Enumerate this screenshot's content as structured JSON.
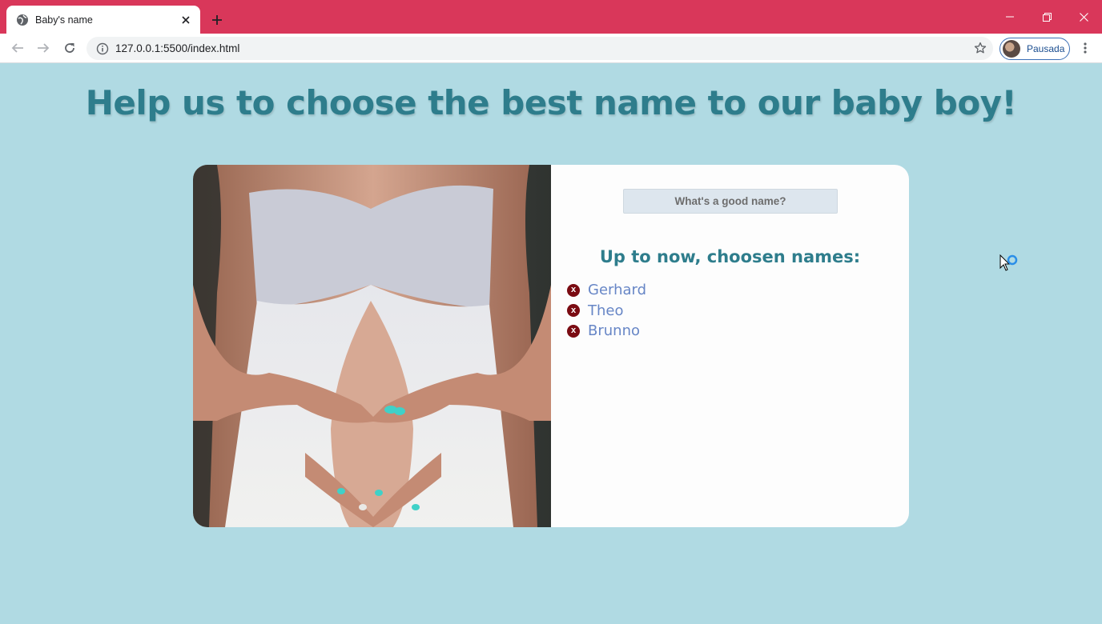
{
  "browser": {
    "tab_title": "Baby's name",
    "url": "127.0.0.1:5500/index.html",
    "profile_label": "Pausada",
    "accent_color": "#d9375a"
  },
  "page": {
    "headline": "Help us to choose the best name to our baby boy!",
    "input_placeholder": "What's a good name?",
    "list_title": "Up to now, choosen names:",
    "remove_label": "x",
    "names": [
      "Gerhard",
      "Theo",
      "Brunno"
    ],
    "background_color": "#b0dae3",
    "title_color": "#2e7d8c",
    "name_color": "#6786c6",
    "remove_color": "#7a0b12"
  },
  "icons": [
    "globe-icon",
    "close-icon",
    "plus-icon",
    "minimize-icon",
    "restore-icon",
    "back-arrow-icon",
    "forward-arrow-icon",
    "reload-icon",
    "info-icon",
    "star-icon",
    "menu-dots-icon",
    "cursor-icon"
  ]
}
